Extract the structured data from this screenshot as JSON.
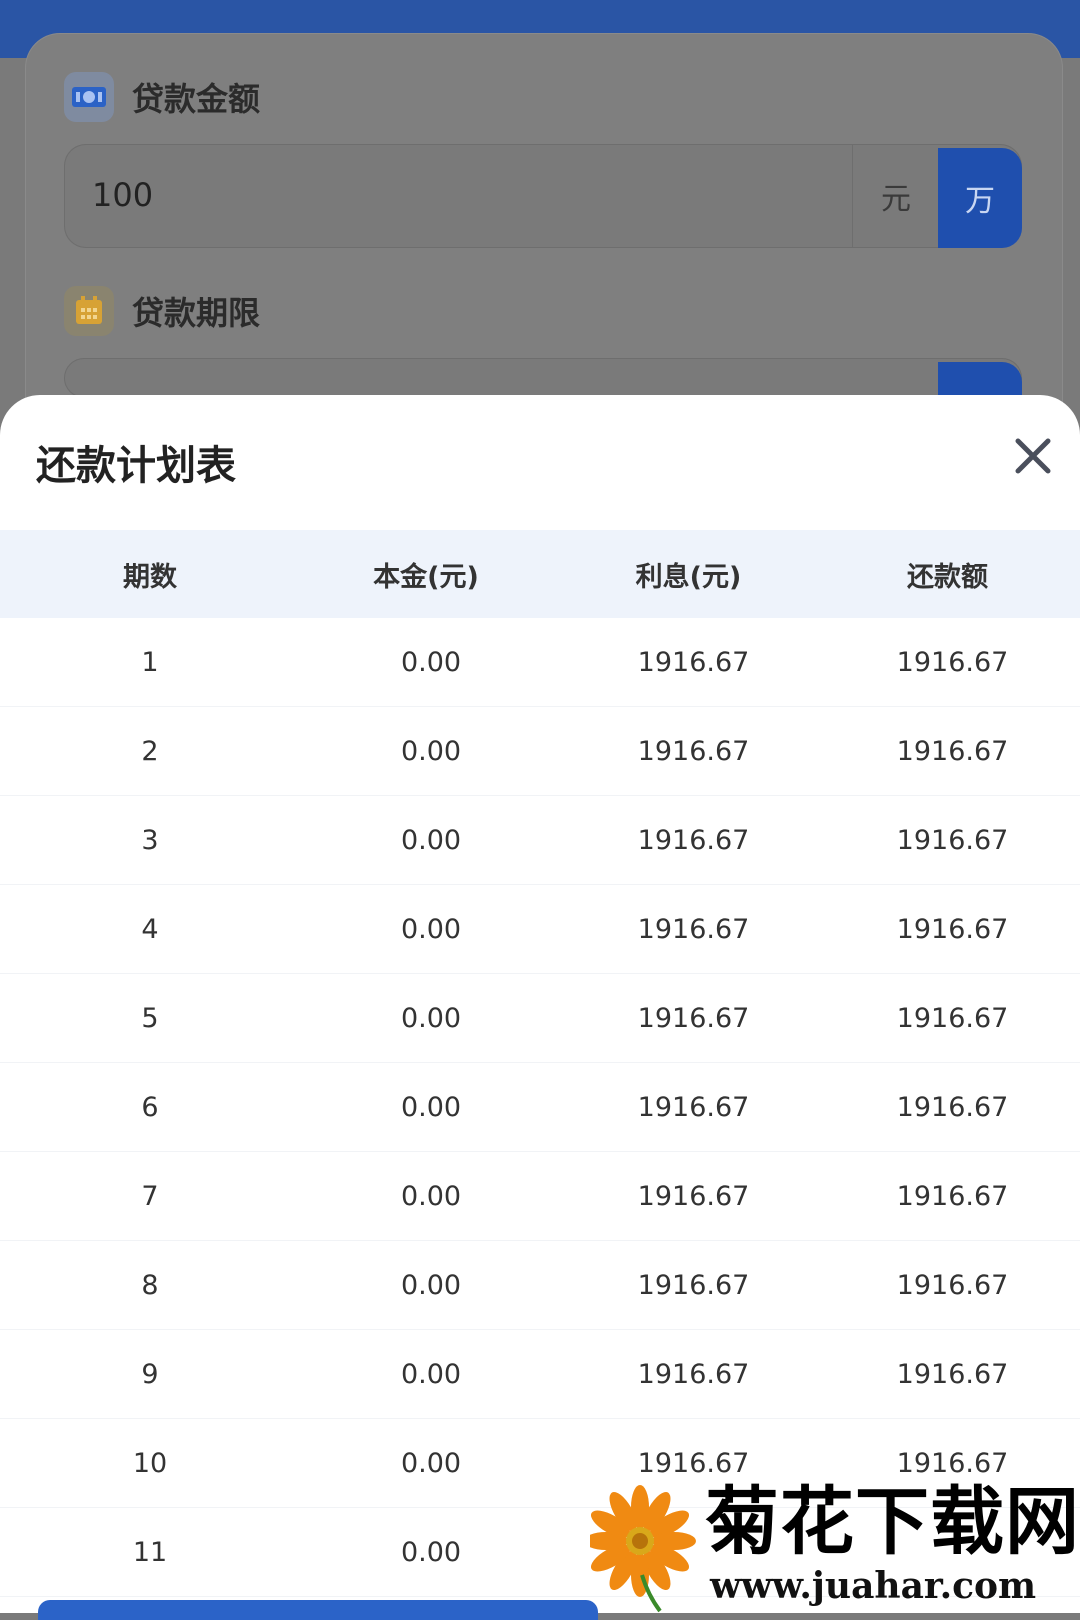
{
  "form": {
    "amount": {
      "label": "贷款金额",
      "value": "100",
      "unit_yuan": "元",
      "unit_wan": "万"
    },
    "term": {
      "label": "贷款期限"
    }
  },
  "sheet": {
    "title": "还款计划表",
    "columns": [
      "期数",
      "本金(元)",
      "利息(元)",
      "还款额"
    ],
    "rows": [
      [
        "1",
        "0.00",
        "1916.67",
        "1916.67"
      ],
      [
        "2",
        "0.00",
        "1916.67",
        "1916.67"
      ],
      [
        "3",
        "0.00",
        "1916.67",
        "1916.67"
      ],
      [
        "4",
        "0.00",
        "1916.67",
        "1916.67"
      ],
      [
        "5",
        "0.00",
        "1916.67",
        "1916.67"
      ],
      [
        "6",
        "0.00",
        "1916.67",
        "1916.67"
      ],
      [
        "7",
        "0.00",
        "1916.67",
        "1916.67"
      ],
      [
        "8",
        "0.00",
        "1916.67",
        "1916.67"
      ],
      [
        "9",
        "0.00",
        "1916.67",
        "1916.67"
      ],
      [
        "10",
        "0.00",
        "1916.67",
        "1916.67"
      ],
      [
        "11",
        "0.00",
        "",
        ""
      ]
    ]
  },
  "watermark": {
    "title": "菊花下载网",
    "url": "www.juahar.com"
  },
  "icons": [
    "money-icon",
    "calendar-icon",
    "close-icon",
    "flower-logo-icon"
  ],
  "colors": {
    "primary": "#2a55a5",
    "header_bg": "#eef3fb"
  }
}
